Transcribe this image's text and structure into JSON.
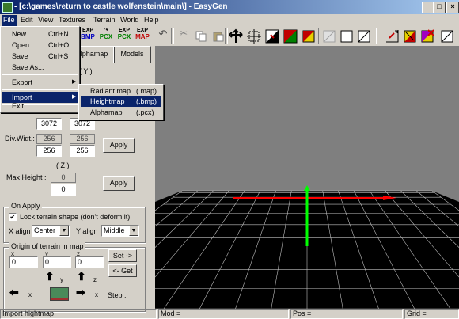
{
  "window": {
    "title": "- [c:\\games\\return to castle wolfenstein\\main\\] - EasyGen"
  },
  "menubar": {
    "items": [
      "File",
      "Edit",
      "View",
      "Textures",
      "Terrain",
      "World",
      "Help"
    ]
  },
  "toolbar": {
    "exp_label": "EXP",
    "bmp_label": "BMP",
    "pcx_label": "PCX",
    "map_label": "MAP",
    "icons": [
      "new-icon",
      "open-icon",
      "save-icon",
      "export-bmp-icon",
      "import-pcx-icon",
      "export-pcx-icon",
      "export-map-icon",
      "undo-icon",
      "cut-icon",
      "copy-icon",
      "paste-icon",
      "move-icon",
      "grid-icon",
      "paint-icon",
      "color-icon",
      "fill-icon",
      "erase-icon",
      "square-icon",
      "slash-icon",
      "diagonal-icon",
      "raise-icon",
      "lower-icon",
      "delete-icon"
    ]
  },
  "file_menu": {
    "items": [
      {
        "label": "New",
        "shortcut": "Ctrl+N"
      },
      {
        "label": "Open...",
        "shortcut": "Ctrl+O"
      },
      {
        "label": "Save",
        "shortcut": "Ctrl+S"
      },
      {
        "label": "Save As...",
        "shortcut": ""
      },
      {
        "label": "Export",
        "shortcut": ""
      },
      {
        "label": "Import",
        "shortcut": ""
      },
      {
        "label": "Exit",
        "shortcut": ""
      }
    ]
  },
  "import_menu": {
    "items": [
      {
        "label": "Radiant map",
        "ext": "(.map)"
      },
      {
        "label": "Heightmap",
        "ext": "(.bmp)"
      },
      {
        "label": "Alphamap",
        "ext": "(.pcx)"
      }
    ]
  },
  "panel": {
    "tabs": [
      "lphamap",
      "Models"
    ],
    "y_header": "( Y )",
    "size_x": "3072",
    "size_y": "3072",
    "div_label": "Div.Widt.:",
    "div_x_ro": "256",
    "div_y_ro": "256",
    "div_x": "256",
    "div_y": "256",
    "apply_label": "Apply",
    "z_header": "( Z )",
    "max_height_label": "Max Height :",
    "max_height_ro": "0",
    "max_height": "0",
    "on_apply_label": "On Apply",
    "lock_label": "Lock terrain shape (don't deform it)",
    "lock_checked": "✔",
    "x_align_label": "X align",
    "x_align_value": "Center",
    "y_align_label": "Y align",
    "y_align_value": "Middle",
    "origin_label": "Origin of terrain in map",
    "origin_x_label": "x",
    "origin_y_label": "y",
    "origin_z_label": "z",
    "origin_x": "0",
    "origin_y": "0",
    "origin_z": "0",
    "set_label": "Set ->",
    "get_label": "<- Get",
    "step_label": "Step :",
    "arrow_y_label": "y",
    "arrow_z_label": "z",
    "arrow_x_label": "x",
    "arrow_x2_label": "x"
  },
  "statusbar": {
    "message": "Import hightmap",
    "mod_label": "Mod =",
    "pos_label": "Pos =",
    "grid_label": "Grid ="
  },
  "colors": {
    "title_start": "#0a246a",
    "title_end": "#a6caf0",
    "terrain_grid": "#bfbfbf",
    "axis_red": "#ff0000",
    "axis_green": "#00ff00"
  }
}
